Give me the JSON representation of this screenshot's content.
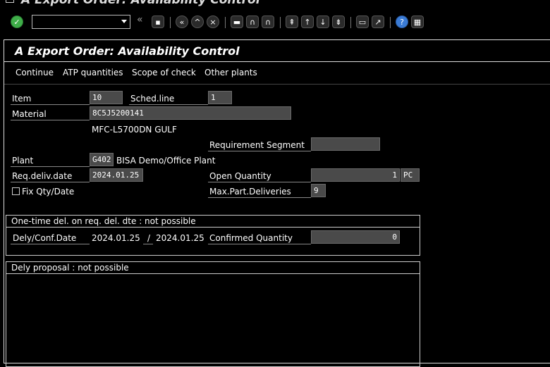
{
  "window": {
    "title": "A Export Order: Availability Control"
  },
  "toolbar": {
    "command_field_value": "",
    "icons": [
      "enter-icon",
      "save-icon",
      "back-icon",
      "exit-icon",
      "cancel-icon",
      "print-icon",
      "find-icon",
      "find-next-icon",
      "first-page-icon",
      "previous-page-icon",
      "next-page-icon",
      "last-page-icon",
      "create-session-icon",
      "generate-shortcut-icon",
      "help-icon",
      "customize-layout-icon"
    ]
  },
  "screen": {
    "title": "A Export Order: Availability Control"
  },
  "menu": {
    "continue": "Continue",
    "atp_quantities": "ATP quantities",
    "scope_of_check": "Scope of check",
    "other_plants": "Other plants"
  },
  "form": {
    "item_label": "Item",
    "item_value": "10",
    "sched_line_label": "Sched.line",
    "sched_line_value": "1",
    "material_label": "Material",
    "material_value": "8C5J5200141",
    "material_desc": "MFC-L5700DN GULF",
    "requirement_segment_label": "Requirement Segment",
    "requirement_segment_value": "",
    "plant_label": "Plant",
    "plant_value": "G402",
    "plant_desc": "BISA Demo/Office Plant",
    "req_deliv_date_label": "Req.deliv.date",
    "req_deliv_date_value": "2024.01.25",
    "open_quantity_label": "Open Quantity",
    "open_quantity_value": "1",
    "open_quantity_unit": "PC",
    "fix_qty_label": "Fix Qty/Date",
    "fix_qty_checked": false,
    "max_part_label": "Max.Part.Deliveries",
    "max_part_value": "9"
  },
  "one_time": {
    "title": "One-time del. on req. del. dte : not possible",
    "dely_conf_label": "Dely/Conf.Date",
    "dely_date": "2024.01.25",
    "separator": "/",
    "conf_date": "2024.01.25",
    "confirmed_qty_label": "Confirmed Quantity",
    "confirmed_qty_value": "0"
  },
  "proposal": {
    "title": "Dely proposal : not possible"
  }
}
